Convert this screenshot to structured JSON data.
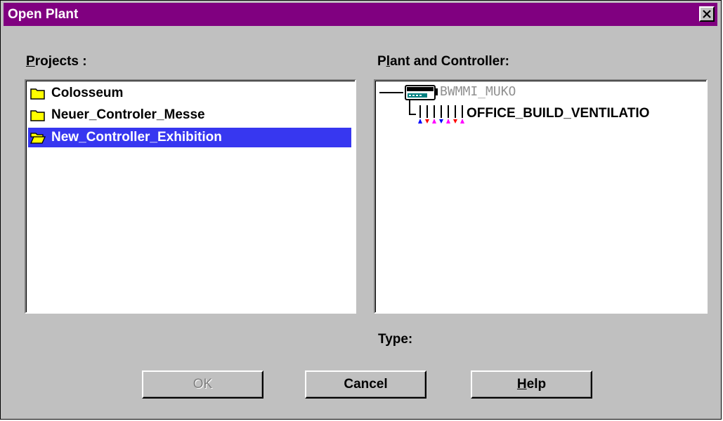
{
  "dialog": {
    "title": "Open Plant",
    "close_glyph": "✕"
  },
  "projects": {
    "label_accel": "P",
    "label_rest": "rojects :",
    "items": [
      {
        "label": "Colosseum",
        "icon": "folder-closed-icon",
        "selected": false
      },
      {
        "label": "Neuer_Controler_Messe",
        "icon": "folder-closed-icon",
        "selected": false
      },
      {
        "label": "New_Controller_Exhibition",
        "icon": "folder-open-icon",
        "selected": true
      }
    ]
  },
  "plant": {
    "label_pre": "P",
    "label_accel": "l",
    "label_rest": "ant and Controller:",
    "controller": {
      "label": "BWMMI_MUKO",
      "icon": "controller-device-icon"
    },
    "plant": {
      "label": "OFFICE_BUILD_VENTILATIO",
      "icon": "plant-symbol-icon"
    }
  },
  "type": {
    "label": "Type:",
    "value": ""
  },
  "buttons": {
    "ok": "OK",
    "cancel": "Cancel",
    "help_accel": "H",
    "help_rest": "elp"
  },
  "colors": {
    "titlebar": "#800080",
    "selection": "#3737f0",
    "face": "#c0c0c0"
  }
}
